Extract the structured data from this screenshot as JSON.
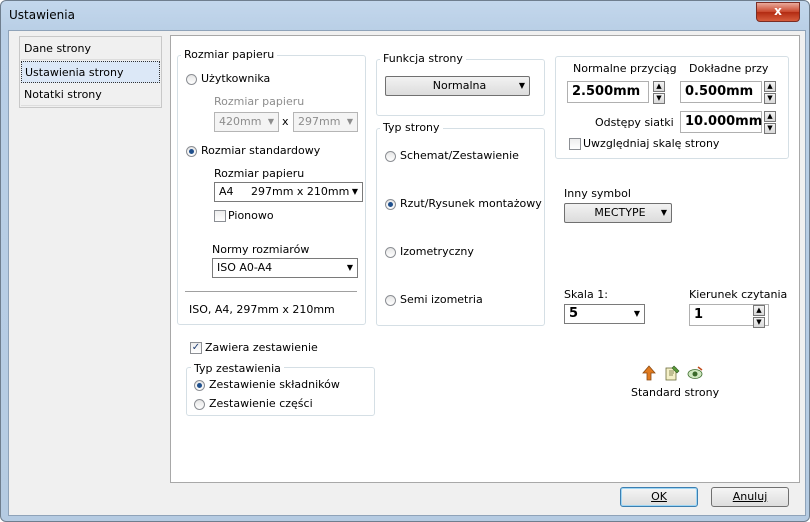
{
  "window": {
    "title": "Ustawienia",
    "close_glyph": "x"
  },
  "nav": {
    "items": [
      "Dane strony",
      "Ustawienia strony",
      "Notatki strony"
    ],
    "selected": 1
  },
  "paper": {
    "group_title": "Rozmiar papieru",
    "user_radio": "Użytkownika",
    "user_size_label": "Rozmiar papieru",
    "user_width": "420mm",
    "x_sep": "x",
    "user_height": "297mm",
    "standard_radio": "Rozmiar standardowy",
    "std_size_label": "Rozmiar papieru",
    "std_size_value": "A4     297mm x 210mm",
    "portrait_label": "Pionowo",
    "norms_label": "Normy rozmiarów",
    "norms_value": "ISO A0-A4",
    "summary": "ISO, A4, 297mm x 210mm"
  },
  "function": {
    "group_title": "Funkcja strony",
    "value": "Normalna"
  },
  "page_type": {
    "group_title": "Typ strony",
    "options": [
      "Schemat/Zestawienie",
      "Rzut/Rysunek montażowy",
      "Izometryczny",
      "Semi izometria"
    ],
    "selected": 1
  },
  "snap": {
    "normal_label": "Normalne przyciąg",
    "normal_value": "2.500mm",
    "precise_label": "Dokładne przy",
    "precise_value": "0.500mm",
    "grid_label": "Odstępy siatki",
    "grid_value": "10.000mm",
    "scale_check_label": "Uwzględniaj skalę strony"
  },
  "symbol": {
    "label": "Inny symbol",
    "value": "MECTYPE"
  },
  "scale": {
    "label": "Skala 1:",
    "value": "5"
  },
  "reading": {
    "label": "Kierunek czytania",
    "value": "1"
  },
  "standard_page": {
    "label": "Standard strony",
    "icons": [
      "arrow-up-icon",
      "edit-page-icon",
      "view-eye-icon"
    ]
  },
  "summary_check": {
    "label": "Zawiera zestawienie",
    "checked": true
  },
  "summary_type": {
    "group_title": "Typ zestawienia",
    "options": [
      "Zestawienie składników",
      "Zestawienie części"
    ],
    "selected": 0
  },
  "buttons": {
    "ok": "OK",
    "cancel": "Anuluj"
  }
}
